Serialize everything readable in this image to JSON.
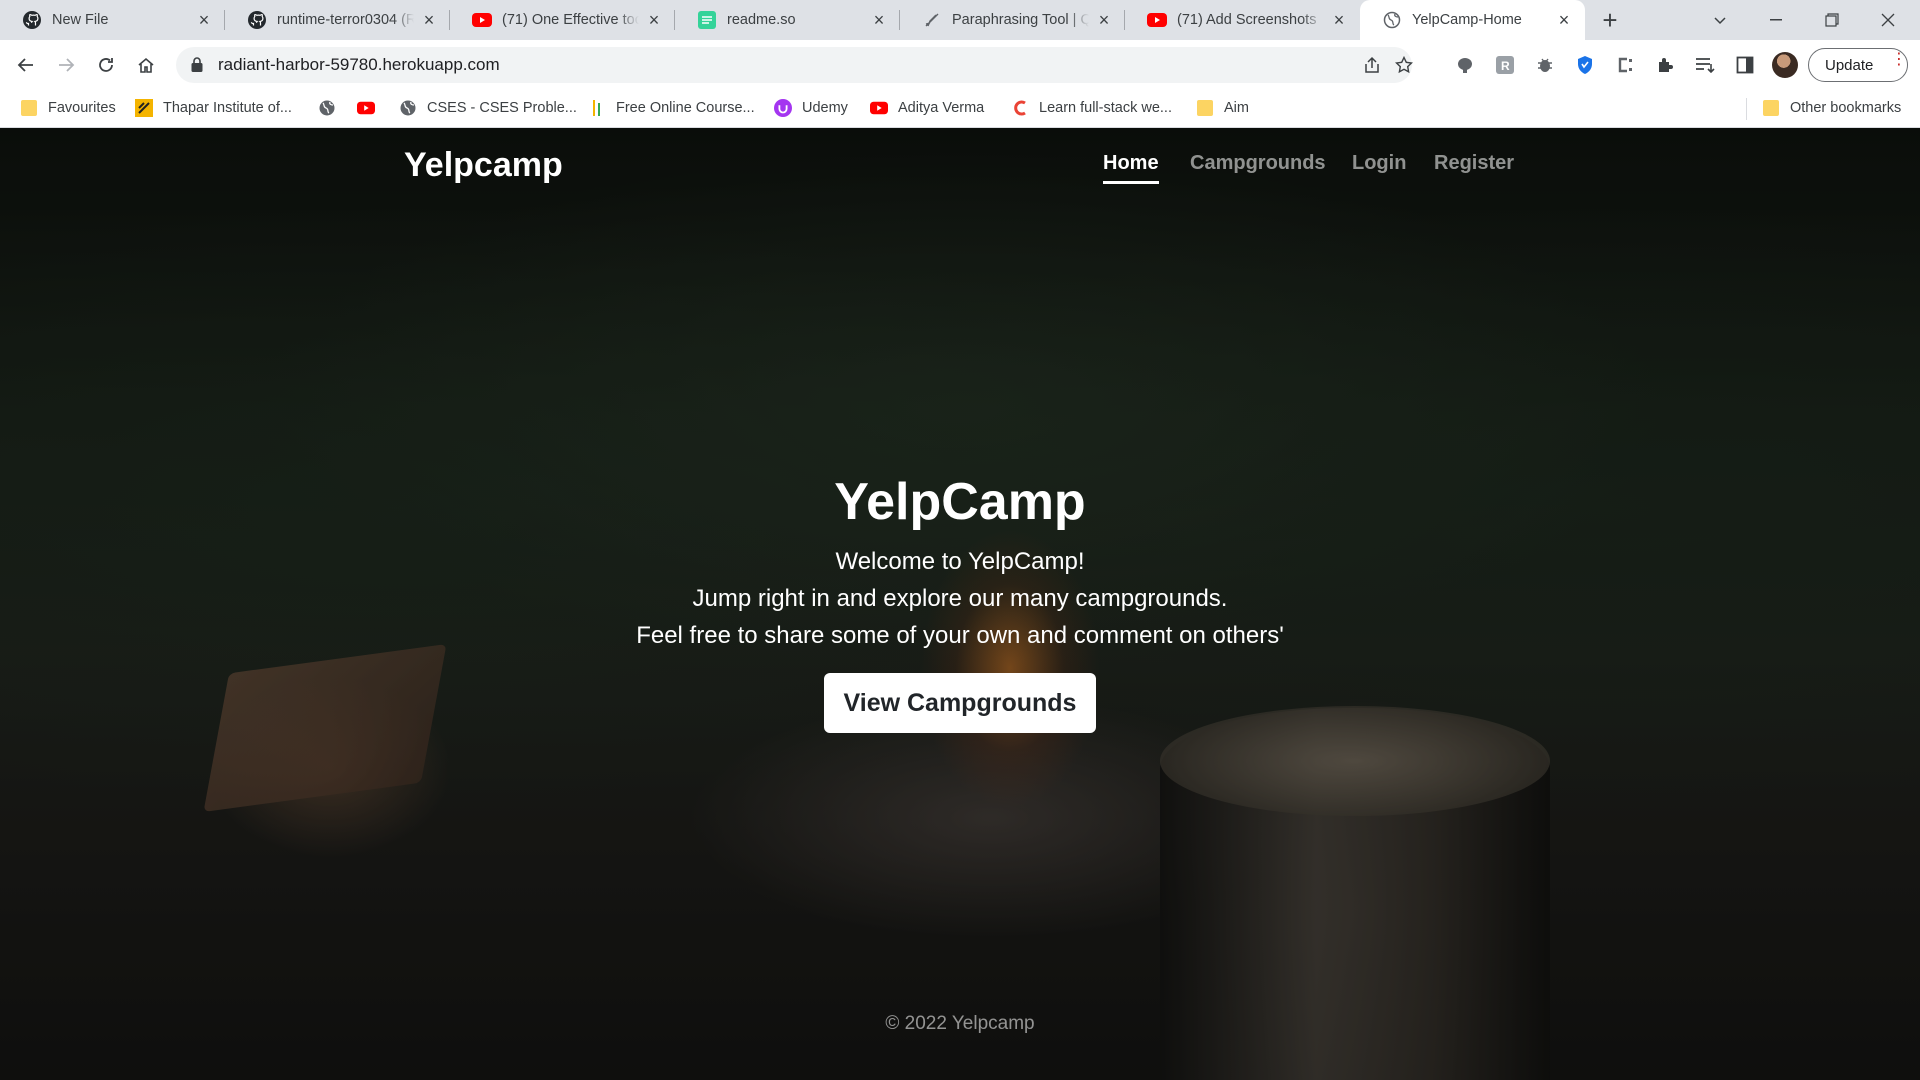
{
  "browser": {
    "tabs": [
      {
        "title": "New File",
        "icon": "github-icon"
      },
      {
        "title": "runtime-terror0304 (R",
        "icon": "github-icon"
      },
      {
        "title": "(71) One Effective too",
        "icon": "youtube-icon"
      },
      {
        "title": "readme.so",
        "icon": "readme-icon"
      },
      {
        "title": "Paraphrasing Tool | Q",
        "icon": "quill-icon"
      },
      {
        "title": "(71) Add Screenshots",
        "icon": "youtube-icon"
      },
      {
        "title": "YelpCamp-Home",
        "icon": "globe-icon"
      }
    ],
    "url": "radiant-harbor-59780.herokuapp.com",
    "update_label": "Update",
    "bookmarks": [
      {
        "label": "Favourites",
        "icon": "folder-icon"
      },
      {
        "label": "Thapar Institute of...",
        "icon": "thapar-icon"
      },
      {
        "label": "",
        "icon": "globe-icon"
      },
      {
        "label": "",
        "icon": "youtube-icon"
      },
      {
        "label": "CSES - CSES Proble...",
        "icon": "globe-icon"
      },
      {
        "label": "Free Online Course...",
        "icon": "course-icon"
      },
      {
        "label": "Udemy",
        "icon": "udemy-icon"
      },
      {
        "label": "Aditya Verma",
        "icon": "youtube-icon"
      },
      {
        "label": "Learn full-stack we...",
        "icon": "c-icon"
      },
      {
        "label": "Aim",
        "icon": "folder-icon"
      }
    ],
    "other_bookmarks": "Other bookmarks"
  },
  "site": {
    "brand": "Yelpcamp",
    "nav": [
      "Home",
      "Campgrounds",
      "Login",
      "Register"
    ],
    "active_nav": "Home",
    "hero_title": "YelpCamp",
    "hero_lines": [
      "Welcome to YelpCamp!",
      "Jump right in and explore our many campgrounds.",
      "Feel free to share some of your own and comment on others'"
    ],
    "cta_label": "View Campgrounds",
    "footer": "© 2022 Yelpcamp"
  },
  "colors": {
    "chrome_bg": "#dee1e6",
    "youtube_red": "#ff0000",
    "page_text": "#ffffff"
  }
}
